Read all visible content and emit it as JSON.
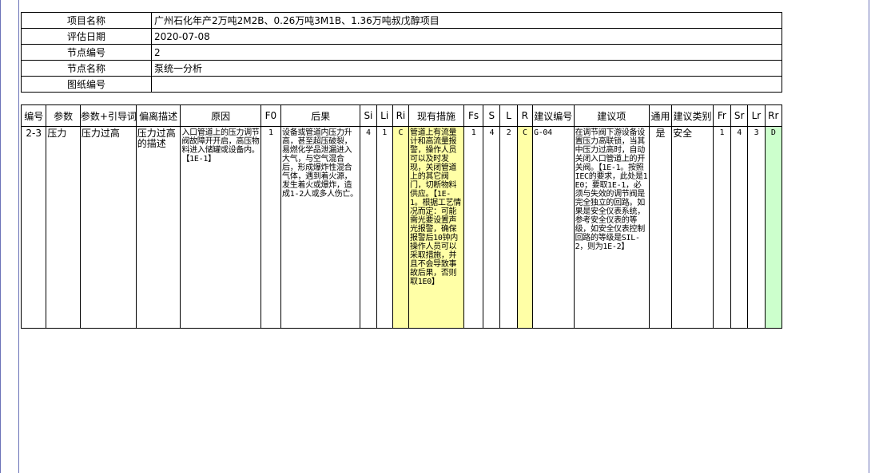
{
  "info": {
    "rows": [
      {
        "key": "项目名称",
        "value": "广州石化年产2万吨2M2B、0.26万吨3M1B、1.36万吨叔戊醇项目"
      },
      {
        "key": "评估日期",
        "value": "2020-07-08"
      },
      {
        "key": "节点编号",
        "value": "2"
      },
      {
        "key": "节点名称",
        "value": "泵统一分析"
      },
      {
        "key": "图纸编号",
        "value": ""
      }
    ]
  },
  "table": {
    "headers": [
      "编号",
      "参数",
      "参数+引导词",
      "偏离描述",
      "原因",
      "F0",
      "后果",
      "Si",
      "Li",
      "Ri",
      "现有措施",
      "Fs",
      "S",
      "L",
      "R",
      "建议编号",
      "建议项",
      "通用",
      "建议类别",
      "Fr",
      "Sr",
      "Lr",
      "Rr"
    ],
    "row": {
      "id": "2-3",
      "param": "压力",
      "param_guide": "压力过高",
      "deviation": "压力过高的描述",
      "cause": "入口管道上的压力调节阀故障开开启，高压物料进入储罐或设备内。【1E-1】",
      "f0": "1",
      "consequence": "设备或管道内压力升高，甚至超压破裂，易燃化学品泄漏进入大气，与空气混合后，形成爆炸性混合气体，遇到着火源，发生着火或爆炸，造成1-2人或多人伤亡。",
      "si": "4",
      "li": "1",
      "ri": "C",
      "safeguards": "管道上有流量计和高流量报警，操作人员可以及时发现，关闭管道上的其它阀门，切断物料供应。【1E-1。根据工艺情况而定：可能需光要设置声光报警，确保报警后10钟内操作人员可以采取措施，并且不会导致事故后果，否则取1E0】",
      "fs": "1",
      "s": "4",
      "l": "2",
      "r": "C",
      "rec_id": "G-04",
      "recommendation": "在调节阀下游设备设置压力高联锁，当其中压力过高时，自动关闭入口管道上的开关阀。【1E-1。按照IEC的要求，此处是1E0；要取1E-1，必须与失效的调节阀是完全独立的回路。如果是安全仪表系统，参考安全仪表的等级，如安全仪表控制回路的等级是SIL-2，则为1E-2】",
      "general": "是",
      "rec_category": "安全",
      "fr": "1",
      "sr": "4",
      "lr": "3",
      "rr": "D"
    }
  },
  "colors": {
    "risk_c": "#ffffa6",
    "risk_d": "#ccffcc",
    "frame_border": "#6c73b8"
  }
}
